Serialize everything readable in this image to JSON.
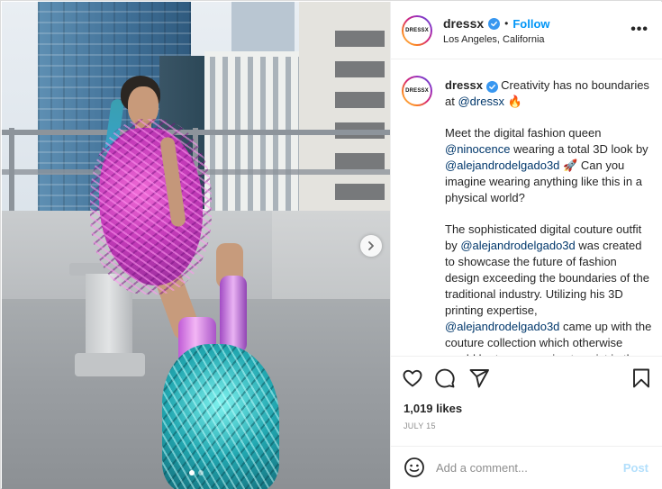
{
  "post": {
    "username": "dressx",
    "location": "Los Angeles, California",
    "separator": "•",
    "follow_label": "Follow",
    "more_label": "•••",
    "avatar_text": "DRESSX",
    "verified": true,
    "icons": {
      "verified": "verified-badge-icon",
      "next": "chevron-right-icon",
      "like": "heart-icon",
      "comment": "comment-icon",
      "share": "paper-plane-icon",
      "save": "bookmark-icon",
      "emoji": "smiley-icon",
      "fire": "fire-emoji",
      "rocket": "rocket-emoji"
    },
    "accent_color": "#0095f6",
    "mention_color": "#00376b"
  },
  "caption": {
    "username": "dressx",
    "intro_text": "Creativity has no boundaries at",
    "intro_mention": "@dressx",
    "intro_emoji": "🔥",
    "p2_a": "Meet the digital fashion queen",
    "p2_mention1": "@ninocence",
    "p2_b": "wearing a total 3D look by",
    "p2_mention2": "@alejandrodelgado3d",
    "p2_emoji": "🚀",
    "p2_c": "Can you imagine wearing anything like this in a physical world?",
    "p3_a": "The sophisticated digital couture outfit by",
    "p3_mention1": "@alejandrodelgado3d",
    "p3_b": "was created to showcase the future of fashion design exceeding the boundaries of the traditional industry. Utilizing his 3D printing expertise,",
    "p3_mention2": "@alejandrodelgado3d",
    "p3_c": "came up with the couture collection which otherwise would be too expensive to exist in the physical realm. In digital, however, the designer was free to"
  },
  "stats": {
    "likes": "1,019 likes",
    "date": "JULY 15"
  },
  "comment": {
    "placeholder": "Add a comment...",
    "post_label": "Post"
  },
  "carousel": {
    "slides": 2,
    "active_index": 0
  }
}
